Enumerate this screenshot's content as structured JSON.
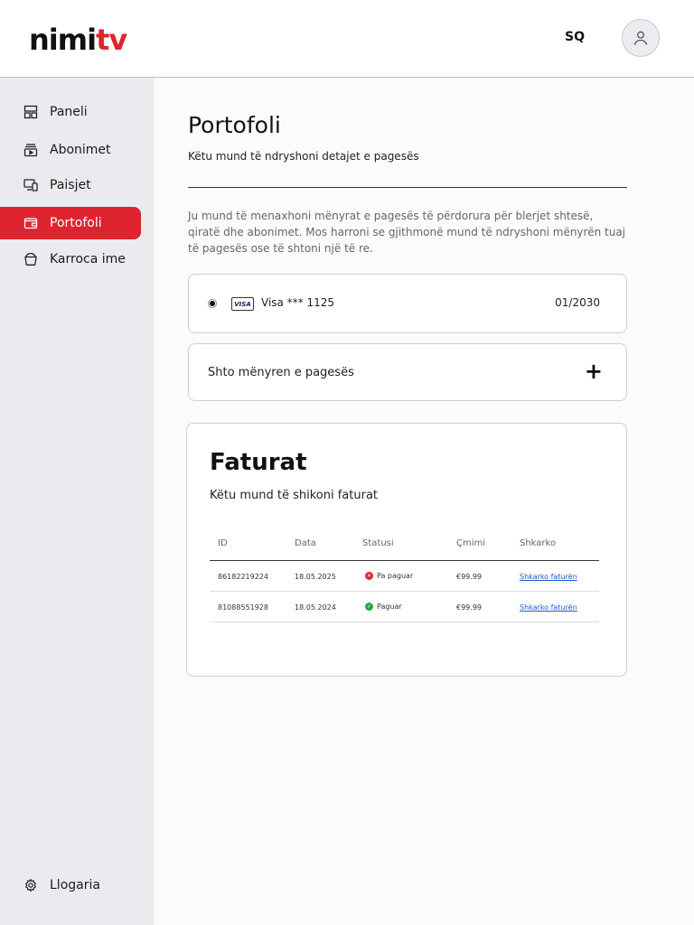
{
  "header": {
    "logo_part1": "nimi",
    "logo_part2": "tv",
    "language": "SQ"
  },
  "colors": {
    "accent": "#e0242f",
    "sidebar_bg": "#ebebef",
    "paid": "#22aa44",
    "unpaid": "#e0242f"
  },
  "sidebar": {
    "items": [
      {
        "label": "Paneli",
        "icon": "dashboard-icon"
      },
      {
        "label": "Abonimet",
        "icon": "subscription-icon"
      },
      {
        "label": "Paisjet",
        "icon": "devices-icon"
      },
      {
        "label": "Portofoli",
        "icon": "wallet-icon",
        "active": true
      },
      {
        "label": "Karroca ime",
        "icon": "cart-icon"
      }
    ],
    "account_label": "Llogaria"
  },
  "main": {
    "title": "Portofoli",
    "subtitle": "Këtu mund të ndryshoni detajet e pagesës",
    "description": "Ju mund të menaxhoni mënyrat e pagesës të përdorura për blerjet shtesë, qiratë dhe abonimet. Mos harroni se gjithmonë mund të ndryshoni mënyrën tuaj të pagesës ose të shtoni një të re.",
    "payment_method": {
      "brand": "VISA",
      "name": "Visa *** 1125",
      "expiry": "01/2030"
    },
    "add_payment_label": "Shto mënyren e pagesës",
    "add_symbol": "+"
  },
  "invoices": {
    "title": "Faturat",
    "subtitle": "Këtu mund të shikoni faturat",
    "columns": [
      "ID",
      "Data",
      "Statusi",
      "Çmimi",
      "Shkarko"
    ],
    "rows": [
      {
        "id": "86182219224",
        "date": "18.05.2025",
        "status": "Pa paguar",
        "paid": false,
        "price": "€99.99",
        "download": "Shkarko faturën"
      },
      {
        "id": "81088551928",
        "date": "18.05.2024",
        "status": "Paguar",
        "paid": true,
        "price": "€99.99",
        "download": "Shkarko faturën"
      }
    ]
  }
}
